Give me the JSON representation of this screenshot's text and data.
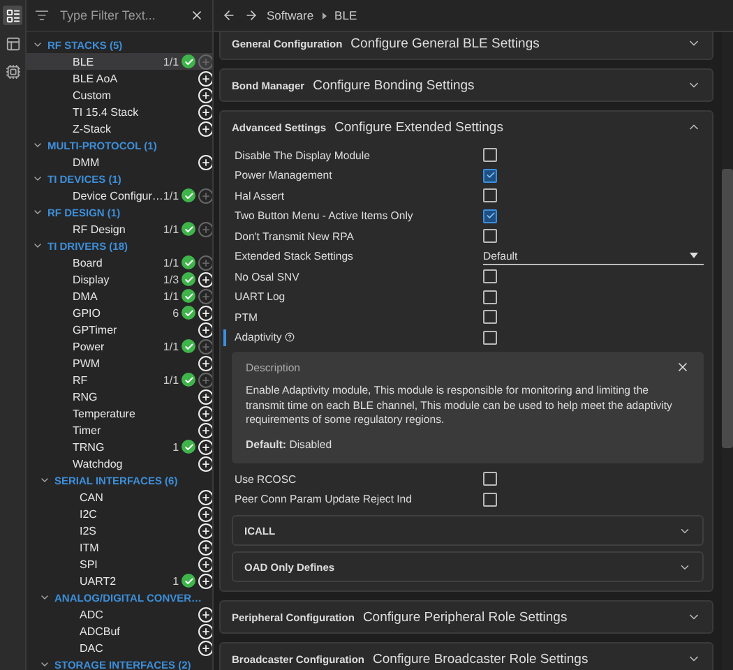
{
  "rail_tabs": [
    {
      "selected": true
    },
    {
      "selected": false
    },
    {
      "selected": false
    }
  ],
  "filter": {
    "placeholder": "Type Filter Text..."
  },
  "tree": [
    {
      "label": "RF STACKS (5)",
      "expanded": true,
      "children": [
        {
          "name": "BLE",
          "count": "1/1",
          "ok": true,
          "add_enabled": false,
          "selected": true
        },
        {
          "name": "BLE AoA",
          "ok": false,
          "add_enabled": true,
          "selected": false
        },
        {
          "name": "Custom",
          "ok": false,
          "add_enabled": true,
          "selected": false
        },
        {
          "name": "TI 15.4 Stack",
          "ok": false,
          "add_enabled": true,
          "selected": false
        },
        {
          "name": "Z-Stack",
          "ok": false,
          "add_enabled": true,
          "selected": false
        }
      ]
    },
    {
      "label": "MULTI-PROTOCOL (1)",
      "expanded": true,
      "children": [
        {
          "name": "DMM",
          "ok": false,
          "add_enabled": true,
          "selected": false
        }
      ]
    },
    {
      "label": "TI DEVICES (1)",
      "expanded": true,
      "children": [
        {
          "name": "Device Configur…",
          "count": "1/1",
          "ok": true,
          "add_enabled": false,
          "selected": false
        }
      ]
    },
    {
      "label": "RF DESIGN (1)",
      "expanded": true,
      "children": [
        {
          "name": "RF Design",
          "count": "1/1",
          "ok": true,
          "add_enabled": false,
          "selected": false
        }
      ]
    },
    {
      "label": "TI DRIVERS (18)",
      "expanded": true,
      "children": [
        {
          "name": "Board",
          "count": "1/1",
          "ok": true,
          "add_enabled": false,
          "selected": false
        },
        {
          "name": "Display",
          "count": "1/3",
          "ok": true,
          "add_enabled": true,
          "selected": false
        },
        {
          "name": "DMA",
          "count": "1/1",
          "ok": true,
          "add_enabled": false,
          "selected": false
        },
        {
          "name": "GPIO",
          "count": "6",
          "ok": true,
          "add_enabled": true,
          "selected": false
        },
        {
          "name": "GPTimer",
          "ok": false,
          "add_enabled": true,
          "selected": false
        },
        {
          "name": "Power",
          "count": "1/1",
          "ok": true,
          "add_enabled": false,
          "selected": false
        },
        {
          "name": "PWM",
          "ok": false,
          "add_enabled": true,
          "selected": false
        },
        {
          "name": "RF",
          "count": "1/1",
          "ok": true,
          "add_enabled": false,
          "selected": false
        },
        {
          "name": "RNG",
          "ok": false,
          "add_enabled": true,
          "selected": false
        },
        {
          "name": "Temperature",
          "ok": false,
          "add_enabled": true,
          "selected": false
        },
        {
          "name": "Timer",
          "ok": false,
          "add_enabled": true,
          "selected": false
        },
        {
          "name": "TRNG",
          "count": "1",
          "ok": true,
          "add_enabled": true,
          "selected": false
        },
        {
          "name": "Watchdog",
          "ok": false,
          "add_enabled": true,
          "selected": false
        }
      ]
    },
    {
      "label": "SERIAL INTERFACES (6)",
      "expanded": true,
      "nested": true,
      "children": [
        {
          "name": "CAN",
          "ok": false,
          "add_enabled": true,
          "selected": false
        },
        {
          "name": "I2C",
          "ok": false,
          "add_enabled": true,
          "selected": false
        },
        {
          "name": "I2S",
          "ok": false,
          "add_enabled": true,
          "selected": false
        },
        {
          "name": "ITM",
          "ok": false,
          "add_enabled": true,
          "selected": false
        },
        {
          "name": "SPI",
          "ok": false,
          "add_enabled": true,
          "selected": false
        },
        {
          "name": "UART2",
          "count": "1",
          "ok": true,
          "add_enabled": true,
          "selected": false
        }
      ]
    },
    {
      "label": "ANALOG/DIGITAL CONVER…",
      "expanded": true,
      "nested": true,
      "children": [
        {
          "name": "ADC",
          "ok": false,
          "add_enabled": true,
          "selected": false
        },
        {
          "name": "ADCBuf",
          "ok": false,
          "add_enabled": true,
          "selected": false
        },
        {
          "name": "DAC",
          "ok": false,
          "add_enabled": true,
          "selected": false
        }
      ]
    },
    {
      "label": "STORAGE INTERFACES (2)",
      "expanded": true,
      "nested": true
    }
  ],
  "breadcrumb": [
    "Software",
    "BLE"
  ],
  "sections": [
    {
      "title": "General Configuration",
      "subtitle": "Configure General BLE Settings",
      "expanded": false
    },
    {
      "title": "Bond Manager",
      "subtitle": "Configure Bonding Settings",
      "expanded": false
    },
    {
      "title": "Advanced Settings",
      "subtitle": "Configure Extended Settings",
      "expanded": true,
      "settings": [
        {
          "kind": "checkbox",
          "label": "Disable The Display Module",
          "checked": false,
          "focused": false,
          "help": false
        },
        {
          "kind": "checkbox",
          "label": "Power Management",
          "checked": true,
          "focused": false,
          "help": false
        },
        {
          "kind": "checkbox",
          "label": "Hal Assert",
          "checked": false,
          "focused": false,
          "help": false
        },
        {
          "kind": "checkbox",
          "label": "Two Button Menu - Active Items Only",
          "checked": true,
          "focused": false,
          "help": false
        },
        {
          "kind": "checkbox",
          "label": "Don't Transmit New RPA",
          "checked": false,
          "focused": false,
          "help": false
        },
        {
          "kind": "select",
          "label": "Extended Stack Settings",
          "value": "Default"
        },
        {
          "kind": "checkbox",
          "label": "No Osal SNV",
          "checked": false,
          "focused": false,
          "help": false
        },
        {
          "kind": "checkbox",
          "label": "UART Log",
          "checked": false,
          "focused": false,
          "help": false
        },
        {
          "kind": "checkbox",
          "label": "PTM",
          "checked": false,
          "focused": false,
          "help": false
        },
        {
          "kind": "checkbox",
          "label": "Adaptivity",
          "checked": false,
          "focused": true,
          "help": true
        },
        {
          "kind": "description",
          "title": "Description",
          "text": "Enable Adaptivity module, This module is responsible for monitoring and limiting the transmit time on each BLE channel, This module can be used to help meet the adaptivity requirements of some regulatory regions.",
          "default": "**Default:** Disabled"
        },
        {
          "kind": "checkbox",
          "label": "Use RCOSC",
          "checked": false,
          "focused": false,
          "help": false
        },
        {
          "kind": "checkbox",
          "label": "Peer Conn Param Update Reject Ind",
          "checked": false,
          "focused": false,
          "help": false
        }
      ],
      "subsections": [
        {
          "title": "ICALL",
          "expanded": false
        },
        {
          "title": "OAD Only Defines",
          "expanded": false
        }
      ]
    },
    {
      "title": "Peripheral Configuration",
      "subtitle": "Configure Peripheral Role Settings",
      "expanded": false
    },
    {
      "title": "Broadcaster Configuration",
      "subtitle": "Configure Broadcaster Role Settings",
      "expanded": false
    }
  ]
}
